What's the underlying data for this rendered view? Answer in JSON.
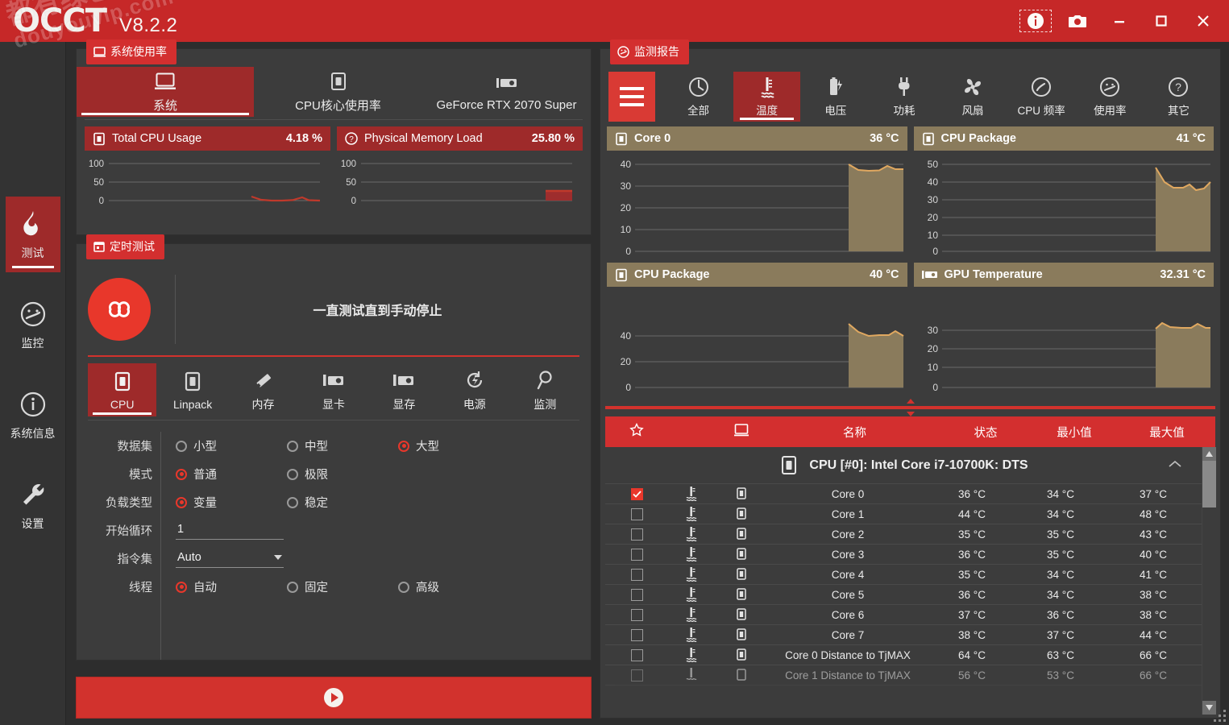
{
  "titlebar": {
    "logo": "OCCT",
    "version": "V8.2.2",
    "buttons": [
      {
        "name": "info-icon",
        "label": "i"
      },
      {
        "name": "camera-icon",
        "label": "screenshot"
      },
      {
        "name": "minimize-icon",
        "label": "minimize"
      },
      {
        "name": "maximize-icon",
        "label": "maximize"
      },
      {
        "name": "close-icon",
        "label": "close"
      }
    ]
  },
  "watermark": {
    "line1": "都有绿色",
    "line2": "douyouvip.com"
  },
  "sidebar": {
    "items": [
      {
        "label": "测试",
        "icon": "flame-icon",
        "active": true
      },
      {
        "label": "监控",
        "icon": "gauge-icon",
        "active": false
      },
      {
        "label": "系统信息",
        "icon": "info-circle-icon",
        "active": false
      },
      {
        "label": "设置",
        "icon": "wrench-icon",
        "active": false
      }
    ]
  },
  "usage_panel": {
    "tag": "系统使用率",
    "tabs": [
      {
        "label": "系统",
        "icon": "monitor-icon",
        "active": true
      },
      {
        "label": "CPU核心使用率",
        "icon": "cpu-icon",
        "active": false
      },
      {
        "label": "GeForce RTX 2070 Super",
        "icon": "gpu-icon",
        "active": false
      }
    ],
    "charts": [
      {
        "name": "Total CPU Usage",
        "value": "4.18 %",
        "icon": "cpu-icon",
        "ticks": [
          "100",
          "50",
          "0"
        ]
      },
      {
        "name": "Physical Memory Load",
        "value": "25.80 %",
        "icon": "question-icon",
        "ticks": [
          "100",
          "50",
          "0"
        ]
      }
    ]
  },
  "test_panel": {
    "tag": "定时测试",
    "duration_text": "一直测试直到手动停止",
    "infinity_symbol": "∞",
    "tabs": [
      {
        "label": "CPU",
        "icon": "cpu-icon",
        "active": true
      },
      {
        "label": "Linpack",
        "icon": "cpu-icon",
        "active": false
      },
      {
        "label": "内存",
        "icon": "memory-icon",
        "active": false
      },
      {
        "label": "显卡",
        "icon": "gpu-icon",
        "active": false
      },
      {
        "label": "显存",
        "icon": "gpu-icon",
        "active": false
      },
      {
        "label": "电源",
        "icon": "power-icon",
        "active": false
      },
      {
        "label": "监测",
        "icon": "magnifier-icon",
        "active": false
      }
    ],
    "form": {
      "dataset": {
        "label": "数据集",
        "options": [
          "小型",
          "中型",
          "大型"
        ],
        "selected": "大型"
      },
      "mode": {
        "label": "模式",
        "options": [
          "普通",
          "极限"
        ],
        "selected": "普通"
      },
      "load_type": {
        "label": "负载类型",
        "options": [
          "变量",
          "稳定"
        ],
        "selected": "变量"
      },
      "start_cycle": {
        "label": "开始循环",
        "value": "1"
      },
      "instruction_set": {
        "label": "指令集",
        "value": "Auto"
      },
      "threads": {
        "label": "线程",
        "options": [
          "自动",
          "固定",
          "高级"
        ],
        "selected": "自动"
      }
    },
    "start_button": "start-test"
  },
  "monitor_panel": {
    "tag": "监测报告",
    "menu_button": "hamburger-menu",
    "tabs": [
      {
        "label": "全部",
        "icon": "all-icon",
        "active": false
      },
      {
        "label": "温度",
        "icon": "thermometer-icon",
        "active": true
      },
      {
        "label": "电压",
        "icon": "battery-icon",
        "active": false
      },
      {
        "label": "功耗",
        "icon": "plug-icon",
        "active": false
      },
      {
        "label": "风扇",
        "icon": "fan-icon",
        "active": false
      },
      {
        "label": "CPU 频率",
        "icon": "speedometer-icon",
        "active": false
      },
      {
        "label": "使用率",
        "icon": "gauge-icon",
        "active": false
      },
      {
        "label": "其它",
        "icon": "question-icon",
        "active": false
      }
    ],
    "table": {
      "headers": {
        "star": "star-icon",
        "type": "type-icon",
        "device": "monitor-icon",
        "name": "名称",
        "value": "状态",
        "min": "最小值",
        "max": "最大值"
      },
      "group": {
        "label": "CPU [#0]: Intel Core i7-10700K: DTS",
        "icon": "cpu-icon",
        "collapse": "chevron-up-icon"
      },
      "rows": [
        {
          "checked": true,
          "name": "Core 0",
          "value": "36 °C",
          "min": "34 °C",
          "max": "37 °C"
        },
        {
          "checked": false,
          "name": "Core 1",
          "value": "44 °C",
          "min": "34 °C",
          "max": "48 °C"
        },
        {
          "checked": false,
          "name": "Core 2",
          "value": "35 °C",
          "min": "35 °C",
          "max": "43 °C"
        },
        {
          "checked": false,
          "name": "Core 3",
          "value": "36 °C",
          "min": "35 °C",
          "max": "40 °C"
        },
        {
          "checked": false,
          "name": "Core 4",
          "value": "35 °C",
          "min": "34 °C",
          "max": "41 °C"
        },
        {
          "checked": false,
          "name": "Core 5",
          "value": "36 °C",
          "min": "34 °C",
          "max": "38 °C"
        },
        {
          "checked": false,
          "name": "Core 6",
          "value": "37 °C",
          "min": "36 °C",
          "max": "38 °C"
        },
        {
          "checked": false,
          "name": "Core 7",
          "value": "38 °C",
          "min": "37 °C",
          "max": "44 °C"
        },
        {
          "checked": false,
          "name": "Core 0 Distance to TjMAX",
          "value": "64 °C",
          "min": "63 °C",
          "max": "66 °C"
        },
        {
          "checked": false,
          "name": "Core 1 Distance to TjMAX",
          "value": "56 °C",
          "min": "53 °C",
          "max": "66 °C"
        }
      ]
    }
  },
  "colors": {
    "brand_red": "#d32f2f",
    "dark_red": "#9e2a2a",
    "panel_bg": "#3c3c3c",
    "chart_header_tan": "#8a7b5c",
    "chart_line_orange": "#e0a860",
    "usage_line_red": "#c0392b"
  },
  "chart_data": [
    {
      "type": "line",
      "title": "Total CPU Usage",
      "ylabel": "%",
      "ylim": [
        0,
        100
      ],
      "yticks": [
        0,
        50,
        100
      ],
      "value_now": 4.18,
      "series": [
        {
          "name": "Total CPU Usage",
          "values": [
            8,
            5,
            4,
            4,
            4,
            5,
            8,
            4
          ]
        }
      ],
      "color": "#c0392b"
    },
    {
      "type": "area",
      "title": "Physical Memory Load",
      "ylabel": "%",
      "ylim": [
        0,
        100
      ],
      "yticks": [
        0,
        50,
        100
      ],
      "value_now": 25.8,
      "series": [
        {
          "name": "Physical Memory Load",
          "values": [
            26,
            26,
            26,
            26,
            26,
            26
          ]
        }
      ],
      "color": "#c0392b"
    },
    {
      "type": "area",
      "title": "Core 0",
      "ylabel": "°C",
      "ylim": [
        0,
        40
      ],
      "yticks": [
        0,
        10,
        20,
        30,
        40
      ],
      "value_now": 36,
      "series": [
        {
          "name": "Core 0",
          "values": [
            37,
            34,
            34,
            34,
            35,
            37,
            35,
            35
          ]
        }
      ],
      "color": "#e0a860"
    },
    {
      "type": "area",
      "title": "CPU Package",
      "ylabel": "°C",
      "ylim": [
        0,
        50
      ],
      "yticks": [
        0,
        10,
        20,
        30,
        40,
        50
      ],
      "value_now": 41,
      "series": [
        {
          "name": "CPU Package",
          "values": [
            48,
            40,
            37,
            37,
            38,
            42,
            37,
            38,
            41
          ]
        }
      ],
      "color": "#e0a860"
    },
    {
      "type": "area",
      "title": "CPU Package",
      "ylabel": "°C",
      "ylim": [
        0,
        50
      ],
      "yticks": [
        0,
        20,
        40
      ],
      "value_now": 40,
      "series": [
        {
          "name": "CPU Package",
          "values": [
            47,
            43,
            40,
            40,
            41,
            41,
            43,
            40
          ]
        }
      ],
      "color": "#e0a860"
    },
    {
      "type": "area",
      "title": "GPU Temperature",
      "ylabel": "°C",
      "ylim": [
        0,
        35
      ],
      "yticks": [
        0,
        10,
        20,
        30
      ],
      "value_now": 32.31,
      "series": [
        {
          "name": "GPU Temperature",
          "values": [
            31,
            33,
            32,
            32,
            32,
            33,
            32,
            32
          ]
        }
      ],
      "color": "#e0a860"
    }
  ]
}
